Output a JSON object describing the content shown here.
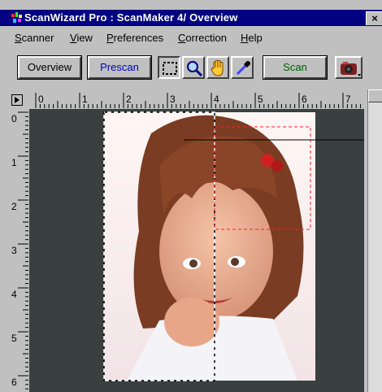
{
  "window": {
    "title": "ScanWizard Pro : ScanMaker 4/ Overview",
    "close_label": "×"
  },
  "menu": [
    {
      "mnemonic": "S",
      "rest": "canner"
    },
    {
      "mnemonic": "V",
      "rest": "iew"
    },
    {
      "mnemonic": "P",
      "rest": "references"
    },
    {
      "mnemonic": "C",
      "rest": "orrection"
    },
    {
      "mnemonic": "H",
      "rest": "elp"
    }
  ],
  "toolbar": {
    "overview_label": "Overview",
    "prescan_label": "Prescan",
    "scan_label": "Scan",
    "tools": [
      "marquee-select-icon",
      "magnifier-icon",
      "hand-icon",
      "eyedropper-icon"
    ],
    "accent_color": "#000080",
    "prescan_color": "#0000c0",
    "scan_color": "#006000"
  },
  "ruler": {
    "h_labels": [
      "0",
      "1",
      "2",
      "3",
      "4",
      "5",
      "6",
      "7"
    ],
    "v_labels": [
      "0",
      "1",
      "2",
      "3",
      "4",
      "5",
      "6"
    ]
  }
}
